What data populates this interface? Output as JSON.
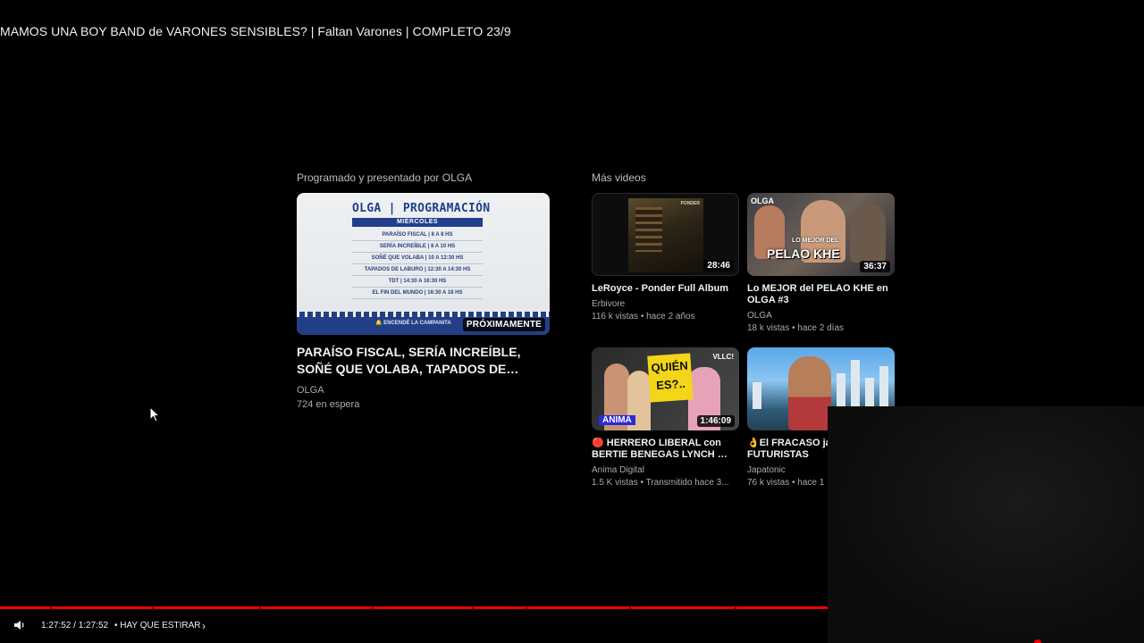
{
  "video_title": "MAMOS UNA BOY BAND de VARONES SENSIBLES? | Faltan Varones | COMPLETO 23/9",
  "sections": {
    "scheduled_label": "Programado y presentado por OLGA",
    "more_label": "Más videos"
  },
  "featured": {
    "thumb": {
      "header": "OLGA | PROGRAMACIÓN",
      "day": "MIÉRCOLES",
      "rows": [
        "PARAÍSO FISCAL | 8 A 8 HS",
        "SERÍA INCREÍBLE | 8 A 10 HS",
        "SOÑÉ QUE VOLABA | 10 A 12:30 HS",
        "TAPADOS DE LABURO | 12:30 A 14:30 HS",
        "TDT | 14:30 A 16:30 HS",
        "EL FIN DEL MUNDO | 16:30 A 18 HS"
      ],
      "campanita": "ENCENDÉ LA CAMPANITA"
    },
    "badge": "PRÓXIMAMENTE",
    "title": "PARAÍSO FISCAL, SERÍA INCREÍBLE, SOÑÉ QUE VOLABA, TAPADOS DE LABURO, TDT y...",
    "channel": "OLGA",
    "waiting": "724 en espera"
  },
  "videos": [
    {
      "title": "LeRoyce - Ponder Full Album",
      "channel": "Erbivore",
      "stats": "116 k vistas • hace 2 años",
      "duration": "28:46",
      "thumb_text": "PONDER"
    },
    {
      "title": "Lo MEJOR del PELAO KHE en OLGA #3",
      "channel": "OLGA",
      "stats": "18 k vistas • hace 2 días",
      "duration": "36:37",
      "thumb_tag": "OLGA",
      "thumb_small": "LO MEJOR DEL",
      "thumb_big": "PELAO KHE"
    },
    {
      "title": "🔴 HERRERO LIBERAL con BERTIE BENEGAS LYNCH 🤙 -...",
      "channel": "Anima Digital",
      "stats": "1.5 K vistas • Transmitido hace 3...",
      "duration": "1:46:09",
      "thumb_q": "QUIÉN ES?..",
      "thumb_tag": "ANIMA",
      "thumb_corner": "VLLC!"
    },
    {
      "title": "👌El FRACASO jap islas FUTURISTAS",
      "channel": "Japatonic",
      "stats": "76 k vistas • hace 1"
    }
  ],
  "player": {
    "timecode": "1:27:52 / 1:27:52",
    "chapter": "• HAY QUE ESTIRAR",
    "progress_percent": 100
  },
  "colors": {
    "progress": "#ee0000",
    "background": "#000000"
  },
  "icons": {
    "volume": "volume-icon",
    "chapter_next": "chevron-right-icon",
    "cursor": "mouse-cursor-icon"
  }
}
